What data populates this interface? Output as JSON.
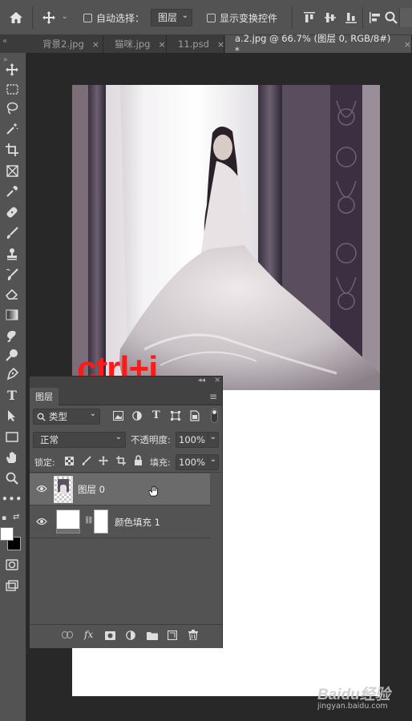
{
  "options_bar": {
    "auto_select_label": "自动选择：",
    "auto_select_target": "图层",
    "show_transform_label": "显示变换控件"
  },
  "tabs": [
    {
      "label": "背景2.jpg",
      "close": "×",
      "active": false
    },
    {
      "label": "猫咪.jpg",
      "close": "×",
      "active": false
    },
    {
      "label": "11.psd",
      "close": "×",
      "active": false
    },
    {
      "label": "a.2.jpg @ 66.7% (图层 0, RGB/8#) *",
      "close": "×",
      "active": true
    }
  ],
  "annotation": {
    "text": "ctrl+j",
    "color": "#ff1a1a"
  },
  "layers_panel": {
    "tab_label": "图层",
    "filter_label": "类型",
    "blend_mode": "正常",
    "opacity_label": "不透明度:",
    "opacity_value": "100%",
    "lock_label": "锁定:",
    "fill_label": "填充:",
    "fill_value": "100%",
    "layers": [
      {
        "name": "图层 0",
        "selected": true
      },
      {
        "name": "颜色填充 1",
        "selected": false
      }
    ]
  },
  "watermark": {
    "logo": "Baidu经验",
    "url": "jingyan.baidu.com"
  },
  "colors": {
    "ui_bg": "#535353",
    "canvas_bg": "#282828",
    "annotation": "#ff1a1a"
  }
}
